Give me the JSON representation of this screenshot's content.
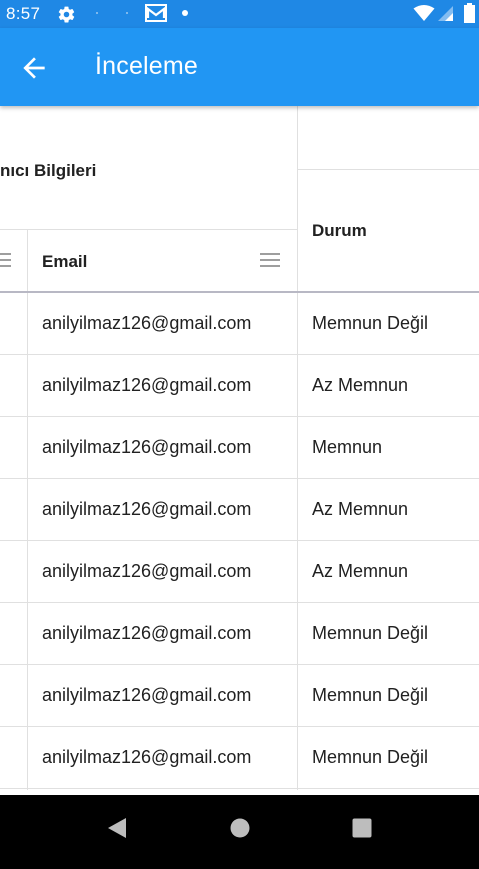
{
  "status_bar": {
    "time": "8:57",
    "left_icons": [
      "gear-icon",
      "gmail-icon",
      "dot-icon"
    ],
    "right_icons": [
      "wifi-icon",
      "signal-icon",
      "battery-icon"
    ]
  },
  "app_bar": {
    "title": "İnceleme",
    "back_icon": "arrow-back-icon",
    "color": "#2196f3"
  },
  "table": {
    "group_header": "nıcı Bilgileri",
    "columns": [
      {
        "label": "Email"
      },
      {
        "label": "Durum"
      }
    ],
    "rows": [
      {
        "email": "anilyilmaz126@gmail.com",
        "durum": "Memnun Değil"
      },
      {
        "email": "anilyilmaz126@gmail.com",
        "durum": "Az Memnun"
      },
      {
        "email": "anilyilmaz126@gmail.com",
        "durum": "Memnun"
      },
      {
        "email": "anilyilmaz126@gmail.com",
        "durum": "Az Memnun"
      },
      {
        "email": "anilyilmaz126@gmail.com",
        "durum": "Az Memnun"
      },
      {
        "email": "anilyilmaz126@gmail.com",
        "durum": "Memnun Değil"
      },
      {
        "email": "anilyilmaz126@gmail.com",
        "durum": "Memnun Değil"
      },
      {
        "email": "anilyilmaz126@gmail.com",
        "durum": "Memnun Değil"
      }
    ]
  },
  "nav_bar": {
    "buttons": [
      "back-triangle-icon",
      "home-circle-icon",
      "recents-square-icon"
    ]
  }
}
